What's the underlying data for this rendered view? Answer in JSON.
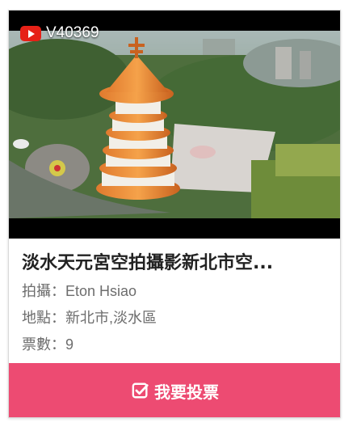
{
  "video": {
    "code": "V40369",
    "icon": "youtube-icon"
  },
  "entry": {
    "title": "淡水天元宮空拍攝影新北市空...",
    "photographer_label": "拍攝：",
    "photographer": "Eton Hsiao",
    "location_label": "地點：",
    "location": "新北市,淡水區",
    "votes_label": "票數：",
    "votes": "9"
  },
  "actions": {
    "vote_label": "我要投票",
    "vote_icon": "check-square-icon"
  },
  "colors": {
    "vote_button": "#ed4b72",
    "youtube_red": "#e62117",
    "meta_text": "#6d6d6d"
  }
}
